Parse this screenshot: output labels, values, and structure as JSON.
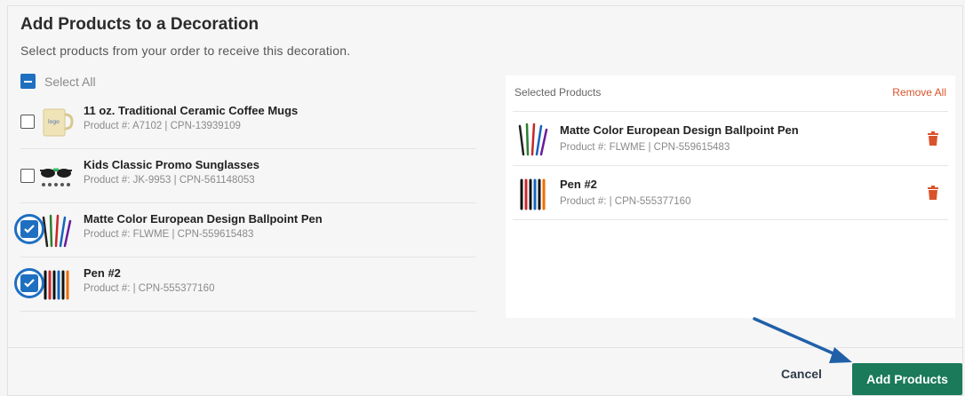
{
  "modal": {
    "title": "Add Products to a Decoration",
    "subtitle": "Select products from your order to receive this decoration.",
    "select_all_label": "Select All"
  },
  "products": [
    {
      "name": "11 oz. Traditional Ceramic Coffee Mugs",
      "number": "Product #: A7102 | CPN-13939109",
      "checked": false,
      "thumb": "mug-thumbnail"
    },
    {
      "name": "Kids Classic Promo Sunglasses",
      "number": "Product #: JK-9953 | CPN-561148053",
      "checked": false,
      "thumb": "sunglasses-thumbnail"
    },
    {
      "name": "Matte Color European Design Ballpoint Pen",
      "number": "Product #: FLWME | CPN-559615483",
      "checked": true,
      "thumb": "pens-thumbnail"
    },
    {
      "name": "Pen #2",
      "number": "Product #:  | CPN-555377160",
      "checked": true,
      "thumb": "pens-thumbnail"
    }
  ],
  "selected_panel": {
    "heading": "Selected Products",
    "remove_all_label": "Remove All",
    "items": [
      {
        "name": "Matte Color European Design Ballpoint Pen",
        "number": "Product #: FLWME | CPN-559615483"
      },
      {
        "name": "Pen #2",
        "number": "Product #:  | CPN-555377160"
      }
    ]
  },
  "footer": {
    "cancel_label": "Cancel",
    "add_label": "Add Products"
  },
  "colors": {
    "accent_blue": "#1f6fc1",
    "primary_green": "#1a7a5a",
    "danger": "#d9542b"
  },
  "icons": {
    "trash": "trash-icon",
    "checkbox": "checkbox-icon",
    "check": "check-icon",
    "arrow": "arrow-annotation"
  }
}
